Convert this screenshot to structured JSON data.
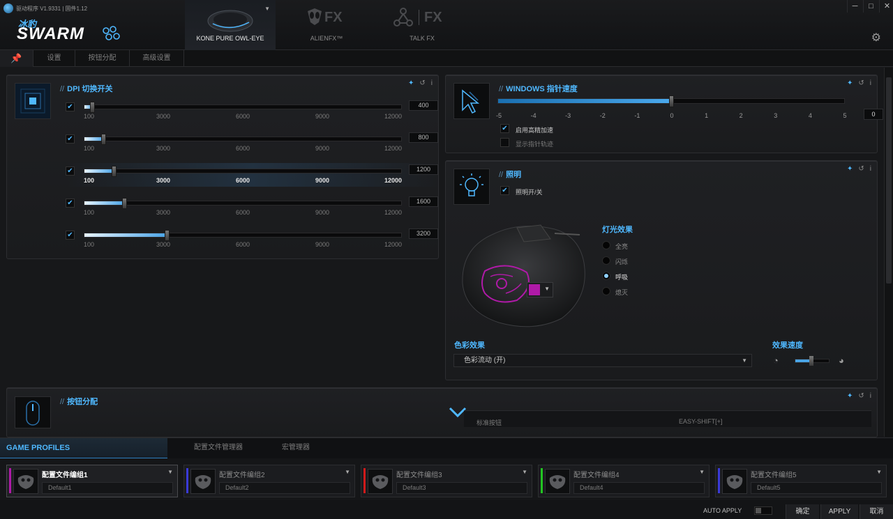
{
  "app": {
    "version_text": "驱动程序 V1.9331 | 固件1.12",
    "logo_cn": "冰豹",
    "logo_text": "SWARM"
  },
  "device_tabs": [
    {
      "label": "KONE PURE OWL-EYE",
      "active": true
    },
    {
      "label": "ALIENFX™",
      "active": false
    },
    {
      "label": "TALK FX",
      "active": false
    }
  ],
  "window_controls": {
    "minimize": "─",
    "maximize": "□",
    "close": "✕"
  },
  "subtabs": [
    {
      "label": "设置"
    },
    {
      "label": "按钮分配"
    },
    {
      "label": "高级设置"
    }
  ],
  "dpi_panel": {
    "title": "DPI 切换开关",
    "ticks": [
      "100",
      "3000",
      "6000",
      "9000",
      "12000"
    ],
    "range": [
      100,
      12000
    ],
    "rows": [
      {
        "value": "400",
        "dpi": 400,
        "checked": true
      },
      {
        "value": "800",
        "dpi": 800,
        "checked": true
      },
      {
        "value": "1200",
        "dpi": 1200,
        "checked": true
      },
      {
        "value": "1600",
        "dpi": 1600,
        "checked": true
      },
      {
        "value": "3200",
        "dpi": 3200,
        "checked": true
      }
    ]
  },
  "windows_panel": {
    "title": "WINDOWS 指针速度",
    "ticks": [
      "-5",
      "-4",
      "-3",
      "-2",
      "-1",
      "0",
      "1",
      "2",
      "3",
      "4",
      "5"
    ],
    "value": "0",
    "value_num": 0,
    "option1": "启用高精加速",
    "option2": "显示指针轨迹",
    "option1_checked": true,
    "option2_checked": false
  },
  "lighting_panel": {
    "title": "照明",
    "toggle_label": "照明开/关",
    "effect_title": "灯光效果",
    "effects": [
      {
        "label": "全亮",
        "selected": false
      },
      {
        "label": "闪烁",
        "selected": false
      },
      {
        "label": "呼吸",
        "selected": true
      },
      {
        "label": "熄灭",
        "selected": false
      }
    ],
    "color_effect_title": "色彩效果",
    "color_effect_value": "色彩流动 (开)",
    "speed_title": "效果速度",
    "speed_level": 0.45,
    "light_color": "#b01aa8"
  },
  "button_panel": {
    "title": "按钮分配",
    "col1": "标准按钮",
    "col2": "EASY-SHIFT[+]"
  },
  "profiles": {
    "tab_label": "GAME PROFILES",
    "sub_tabs": [
      "配置文件管理器",
      "宏管理器"
    ],
    "cards": [
      {
        "name": "配置文件编组1",
        "profile": "Default1",
        "color": "#b01aa8",
        "active": true
      },
      {
        "name": "配置文件编组2",
        "profile": "Default2",
        "color": "#3a3ad8",
        "active": false
      },
      {
        "name": "配置文件编组3",
        "profile": "Default3",
        "color": "#d01a1a",
        "active": false
      },
      {
        "name": "配置文件编组4",
        "profile": "Default4",
        "color": "#22c422",
        "active": false
      },
      {
        "name": "配置文件编组5",
        "profile": "Default5",
        "color": "#3a3ad8",
        "active": false
      }
    ]
  },
  "footer": {
    "auto_apply": "AUTO APPLY",
    "ok": "确定",
    "apply": "APPLY",
    "cancel": "取消"
  },
  "colors": {
    "accent": "#4fb8ff"
  }
}
